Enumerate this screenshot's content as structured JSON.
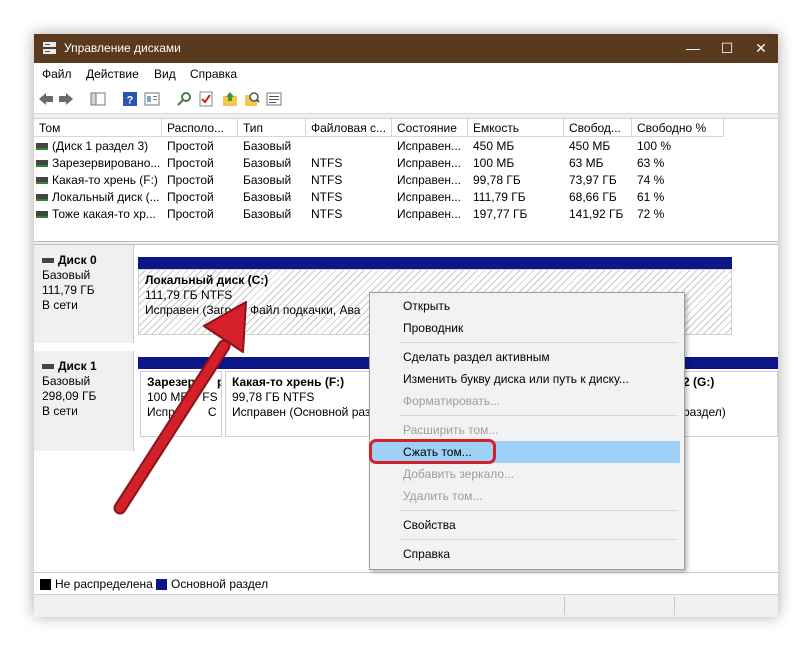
{
  "window": {
    "title": "Управление дисками",
    "controls": [
      "—",
      "☐",
      "✕"
    ]
  },
  "menu": [
    "Файл",
    "Действие",
    "Вид",
    "Справка"
  ],
  "volumes": {
    "columns": [
      "Том",
      "Располо...",
      "Тип",
      "Файловая с...",
      "Состояние",
      "Емкость",
      "Свобод...",
      "Свободно %"
    ],
    "rows": [
      [
        "(Диск 1 раздел 3)",
        "Простой",
        "Базовый",
        "",
        "Исправен...",
        "450 МБ",
        "450 МБ",
        "100 %"
      ],
      [
        "Зарезервировано...",
        "Простой",
        "Базовый",
        "NTFS",
        "Исправен...",
        "100 МБ",
        "63 МБ",
        "63 %"
      ],
      [
        "Какая-то хрень (F:)",
        "Простой",
        "Базовый",
        "NTFS",
        "Исправен...",
        "99,78 ГБ",
        "73,97 ГБ",
        "74 %"
      ],
      [
        "Локальный диск (...",
        "Простой",
        "Базовый",
        "NTFS",
        "Исправен...",
        "111,79 ГБ",
        "68,66 ГБ",
        "61 %"
      ],
      [
        "Тоже какая-то хр...",
        "Простой",
        "Базовый",
        "NTFS",
        "Исправен...",
        "197,77 ГБ",
        "141,92 ГБ",
        "72 %"
      ]
    ]
  },
  "disks": [
    {
      "name": "Диск 0",
      "type": "Базовый",
      "size": "111,79 ГБ",
      "status": "В сети",
      "partitions": [
        {
          "name": "Локальный диск  (C:)",
          "size": "111,79 ГБ NTFS",
          "status": "Исправен (Загр",
          "status_rest": ", Файл подкачки, Ава"
        }
      ]
    },
    {
      "name": "Диск 1",
      "type": "Базовый",
      "size": "298,09 ГБ",
      "status": "В сети",
      "partitions": [
        {
          "name": "Зарезер",
          "name_tail": "р",
          "size": "100 МБ",
          "size_tail": "FS",
          "status": "Исправ",
          "status_tail": "С"
        },
        {
          "name": "Какая-то хрень  (F:)",
          "size": "99,78 ГБ NTFS",
          "status": "Исправен (Основной раз"
        },
        {
          "name": "2  (G:)",
          "status": "раздел)"
        }
      ]
    }
  ],
  "legend": [
    {
      "label": "Не распределена",
      "color": "#000000"
    },
    {
      "label": "Основной раздел",
      "color": "#0c1686"
    }
  ],
  "context_menu": {
    "items": [
      {
        "label": "Открыть",
        "enabled": true
      },
      {
        "label": "Проводник",
        "enabled": true
      },
      {
        "label": "Сделать раздел активным",
        "enabled": true
      },
      {
        "label": "Изменить букву диска или путь к диску...",
        "enabled": true
      },
      {
        "label": "Форматировать...",
        "enabled": false
      },
      {
        "label": "Расширить том...",
        "enabled": false
      },
      {
        "label": "Сжать том...",
        "enabled": true,
        "highlighted": true
      },
      {
        "label": "Добавить зеркало...",
        "enabled": false
      },
      {
        "label": "Удалить том...",
        "enabled": false
      },
      {
        "label": "Свойства",
        "enabled": true
      },
      {
        "label": "Справка",
        "enabled": true
      }
    ]
  },
  "colors": {
    "titlebar": "#5a3a1e",
    "primary_partition": "#0c1686",
    "annotation": "#d4202a",
    "menu_highlight": "#9fd0f5"
  },
  "icons": [
    "back-arrow-icon",
    "forward-arrow-icon",
    "console-tree-icon",
    "help-icon",
    "properties-icon",
    "connect-icon",
    "checklist-icon",
    "folder-up-icon",
    "search-icon",
    "list-icon"
  ]
}
